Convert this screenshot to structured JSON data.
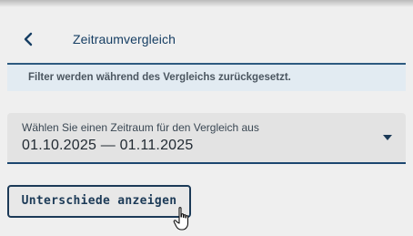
{
  "header": {
    "back_icon": "chevron-left-icon",
    "title": "Zeitraumvergleich"
  },
  "info_banner": {
    "text": "Filter werden während des Vergleichs zurückgesetzt."
  },
  "period_select": {
    "label": "Wählen Sie einen Zeitraum für den Vergleich aus",
    "value": "01.10.2025 — 01.11.2025",
    "icon": "caret-down-icon"
  },
  "compare_button": {
    "label": "Unterschiede anzeigen"
  },
  "cursor": {
    "icon": "hand-pointer-icon"
  },
  "colors": {
    "accent": "#1c4770",
    "banner_bg": "#e2ebf2",
    "background": "#efefef"
  }
}
